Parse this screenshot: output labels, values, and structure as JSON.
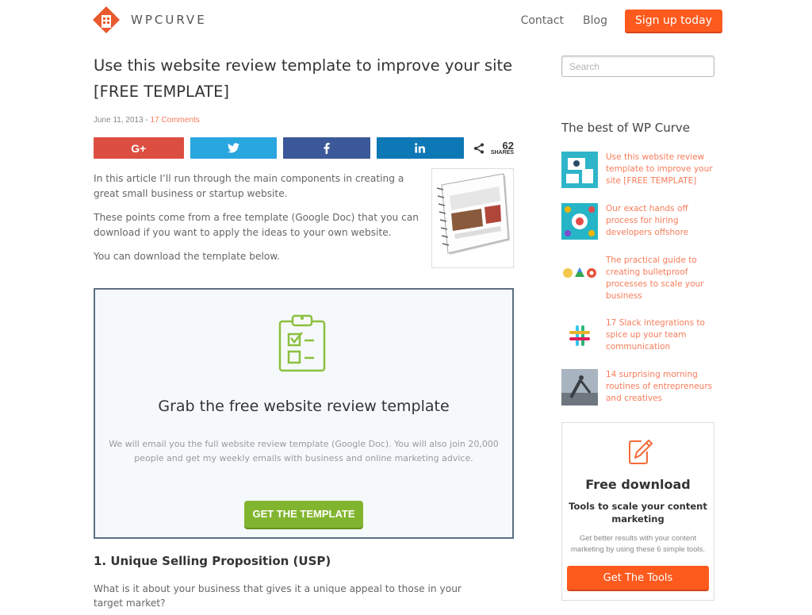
{
  "header": {
    "brand": "WPCURVE",
    "nav": {
      "contact": "Contact",
      "blog": "Blog",
      "signup": "Sign up today"
    }
  },
  "article": {
    "title": "Use this website review template to improve your site [FREE TEMPLATE]",
    "date": "June 11, 2013",
    "date_sep": " - ",
    "comments": "17 Comments",
    "share": {
      "google": "G+",
      "count": "62",
      "count_label": "SHARES"
    },
    "intro": [
      "In this article I’ll run through the main components in creating a great small business or startup website.",
      "These points come from a free template (Google Doc) that you can download if you want to apply the ideas to your own website.",
      "You can download the template below."
    ],
    "optin": {
      "title": "Grab the free website review template",
      "text": "We will email you the full website review template (Google Doc). You will also join 20,000 people and get my weekly emails with business and online marketing advice.",
      "button": "GET THE TEMPLATE"
    },
    "section_heading": "1. Unique Selling Proposition (USP)",
    "section_text": "What is it about your business that gives it a unique appeal to those in your target market?"
  },
  "sidebar": {
    "search_placeholder": "Search",
    "best_heading": "The best of WP Curve",
    "posts": [
      {
        "title": "Use this website review template to improve your site [FREE TEMPLATE]"
      },
      {
        "title": "Our exact hands off process for hiring developers offshore"
      },
      {
        "title": "The practical guide to creating bulletproof processes to scale your business"
      },
      {
        "title": "17 Slack integrations to spice up your team communication"
      },
      {
        "title": "14 surprising morning routines of entrepreneurs and creatives"
      }
    ],
    "download": {
      "title": "Free download",
      "subtitle": "Tools to scale your content marketing",
      "text": "Get better results with your content marketing by using these 6 simple tools.",
      "button": "Get The Tools"
    }
  },
  "colors": {
    "accent": "#fd5a1e",
    "link": "#f77c5a",
    "cta_green": "#82b52f"
  }
}
